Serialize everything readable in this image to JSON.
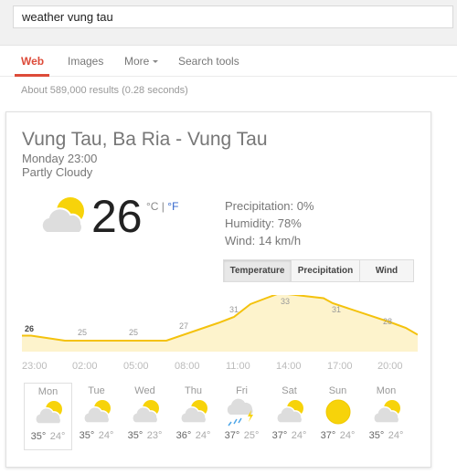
{
  "search": {
    "query": "weather vung tau"
  },
  "tabs": [
    {
      "label": "Web",
      "active": true
    },
    {
      "label": "Images"
    },
    {
      "label": "More"
    },
    {
      "label": "Search tools"
    }
  ],
  "result_stats": "About 589,000 results (0.28 seconds)",
  "weather": {
    "location": "Vung Tau, Ba Ria - Vung Tau",
    "datetime": "Monday 23:00",
    "condition": "Partly Cloudy",
    "current_icon": "partly-cloudy-icon",
    "temperature": "26",
    "unit_c": "°C",
    "unit_sep": " | ",
    "unit_f": "°F",
    "precipitation": "Precipitation: 0%",
    "humidity": "Humidity: 78%",
    "wind": "Wind: 14 km/h",
    "buttons": [
      {
        "label": "Temperature",
        "active": true
      },
      {
        "label": "Precipitation"
      },
      {
        "label": "Wind"
      }
    ],
    "colors": {
      "line": "#f4c20d",
      "fill": "#fdf3cc",
      "sun": "#f7d30a",
      "cloud": "#dddddd",
      "rain": "#4da6e8"
    },
    "days": [
      {
        "name": "Mon",
        "icon": "partly-cloudy-icon",
        "hi": "35°",
        "lo": "24°",
        "selected": true
      },
      {
        "name": "Tue",
        "icon": "partly-cloudy-icon",
        "hi": "35°",
        "lo": "24°"
      },
      {
        "name": "Wed",
        "icon": "partly-cloudy-icon",
        "hi": "35°",
        "lo": "23°"
      },
      {
        "name": "Thu",
        "icon": "partly-cloudy-icon",
        "hi": "36°",
        "lo": "24°"
      },
      {
        "name": "Fri",
        "icon": "thunderstorm-icon",
        "hi": "37°",
        "lo": "25°"
      },
      {
        "name": "Sat",
        "icon": "partly-cloudy-icon",
        "hi": "37°",
        "lo": "24°"
      },
      {
        "name": "Sun",
        "icon": "sunny-icon",
        "hi": "37°",
        "lo": "24°"
      },
      {
        "name": "Mon",
        "icon": "partly-cloudy-icon",
        "hi": "35°",
        "lo": "24°"
      }
    ]
  },
  "chart_data": {
    "type": "area",
    "title": "Temperature",
    "x": [
      "23:00",
      "02:00",
      "05:00",
      "08:00",
      "11:00",
      "14:00",
      "17:00",
      "20:00"
    ],
    "values": [
      26,
      25,
      25,
      27,
      31,
      33,
      31,
      28
    ],
    "xlabel": "",
    "ylabel": "°C",
    "grid": false
  }
}
